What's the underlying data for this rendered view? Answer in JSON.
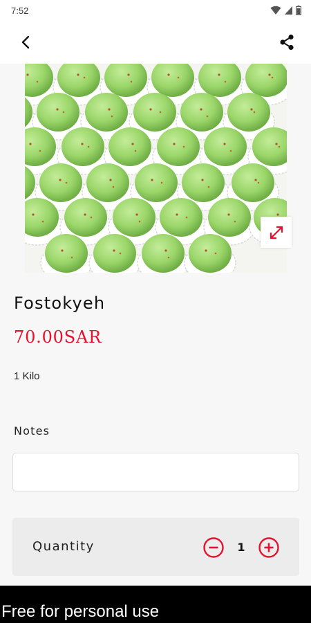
{
  "status_bar": {
    "time": "7:52",
    "icons": [
      "wifi-icon",
      "cell-signal-icon",
      "battery-icon"
    ]
  },
  "app_bar": {
    "back_icon": "back-arrow-icon",
    "share_icon": "share-icon"
  },
  "product": {
    "image": "green pistachio sweets in white paper cups",
    "expand_icon": "expand-icon",
    "name": "Fostokyeh",
    "price": "70.00SAR",
    "weight": "1 Kilo"
  },
  "notes": {
    "label": "Notes",
    "value": "",
    "placeholder": ""
  },
  "quantity": {
    "label": "Quantity",
    "value": "1",
    "minus_icon": "minus-circle-icon",
    "plus_icon": "plus-circle-icon"
  },
  "watermark": {
    "text": "Free for personal use"
  },
  "colors": {
    "accent": "#e8112d",
    "background": "#f7f7f7",
    "card": "#ececec"
  }
}
